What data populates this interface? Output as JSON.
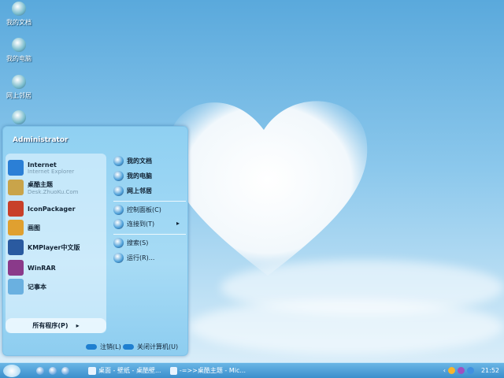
{
  "desktop_icons": [
    {
      "label": "我的文档",
      "icon": "my-documents-icon"
    },
    {
      "label": "我的电脑",
      "icon": "my-computer-icon"
    },
    {
      "label": "网上邻居",
      "icon": "network-places-icon"
    }
  ],
  "start_menu": {
    "user": "Administrator",
    "pinned": [
      {
        "title": "Internet",
        "subtitle": "Internet Explorer",
        "icon": "internet-explorer-icon",
        "color": "#2b7fd6"
      },
      {
        "title": "桌酷主题",
        "subtitle": "Desk.ZhuoKu.Com",
        "icon": "zhuoku-theme-icon",
        "color": "#c9a44a"
      },
      {
        "title": "IconPackager",
        "subtitle": "",
        "icon": "iconpackager-icon",
        "color": "#c8402a"
      },
      {
        "title": "画图",
        "subtitle": "",
        "icon": "paint-icon",
        "color": "#e0a030"
      },
      {
        "title": "KMPlayer中文版",
        "subtitle": "",
        "icon": "kmplayer-icon",
        "color": "#2a5aa0"
      },
      {
        "title": "WinRAR",
        "subtitle": "",
        "icon": "winrar-icon",
        "color": "#8a3a8a"
      },
      {
        "title": "记事本",
        "subtitle": "",
        "icon": "notepad-icon",
        "color": "#6ab0e0"
      }
    ],
    "all_programs": "所有程序(P)",
    "right": [
      {
        "label": "我的文档",
        "bold": true,
        "icon": "my-documents-icon"
      },
      {
        "label": "我的电脑",
        "bold": true,
        "icon": "my-computer-icon"
      },
      {
        "label": "网上邻居",
        "bold": true,
        "icon": "network-places-icon"
      },
      {
        "label": "控制面板(C)",
        "bold": false,
        "icon": "control-panel-icon"
      },
      {
        "label": "连接到(T)",
        "bold": false,
        "icon": "connect-to-icon"
      },
      {
        "label": "搜索(S)",
        "bold": false,
        "icon": "search-icon"
      },
      {
        "label": "运行(R)...",
        "bold": false,
        "icon": "run-icon"
      }
    ],
    "logoff": "注销(L)",
    "shutdown": "关闭计算机(U)"
  },
  "taskbar": {
    "tasks": [
      "桌面 - 壁纸 - 桌酷壁...",
      "-=>>桌酷主题 - Mic..."
    ],
    "clock": "21:52"
  }
}
